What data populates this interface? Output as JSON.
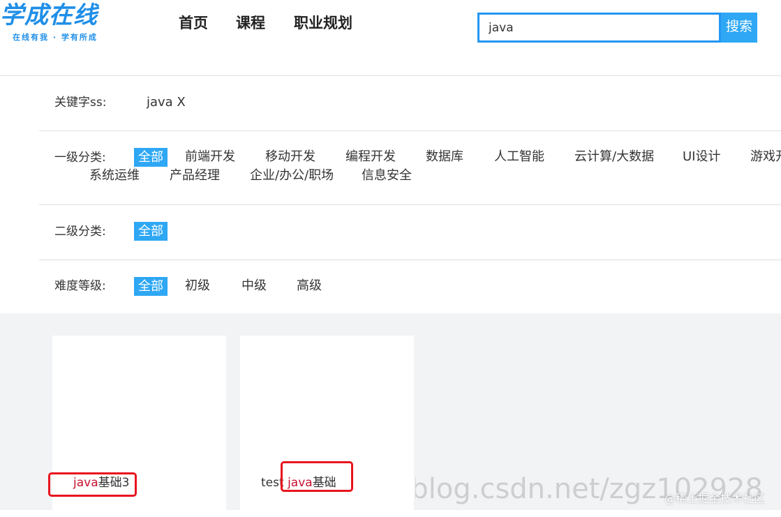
{
  "header": {
    "logo_main": "学成在线",
    "logo_sub": "在线有我 · 学有所成",
    "nav": [
      {
        "label": "首页"
      },
      {
        "label": "课程"
      },
      {
        "label": "职业规划"
      }
    ],
    "search": {
      "value": "java",
      "button_label": "搜索"
    }
  },
  "filters": {
    "keyword": {
      "label": "关键字ss:",
      "value": "java X"
    },
    "level1": {
      "label": "一级分类:",
      "active": "全部",
      "options": [
        "前端开发",
        "移动开发",
        "编程开发",
        "数据库",
        "人工智能",
        "云计算/大数据",
        "UI设计",
        "游戏开发",
        "系统运维",
        "产品经理",
        "企业/办公/职场",
        "信息安全"
      ]
    },
    "level2": {
      "label": "二级分类:",
      "active": "全部"
    },
    "difficulty": {
      "label": "难度等级:",
      "active": "全部",
      "options": [
        "初级",
        "中级",
        "高级"
      ]
    }
  },
  "courses": [
    {
      "prefix": "",
      "highlight": "java",
      "suffix": "基础3"
    },
    {
      "prefix": "test ",
      "highlight": "java",
      "suffix": "基础"
    }
  ],
  "watermark": {
    "csdn": "https://blog.csdn.net/zgz102928",
    "juejin": "@稀土掘金技术社区"
  },
  "colors": {
    "accent": "#2ea7f4",
    "search_border": "#2196f3",
    "highlight_text": "#c8102e",
    "annotation_box": "#e8141e",
    "course_bg": "#f2f3f5"
  }
}
